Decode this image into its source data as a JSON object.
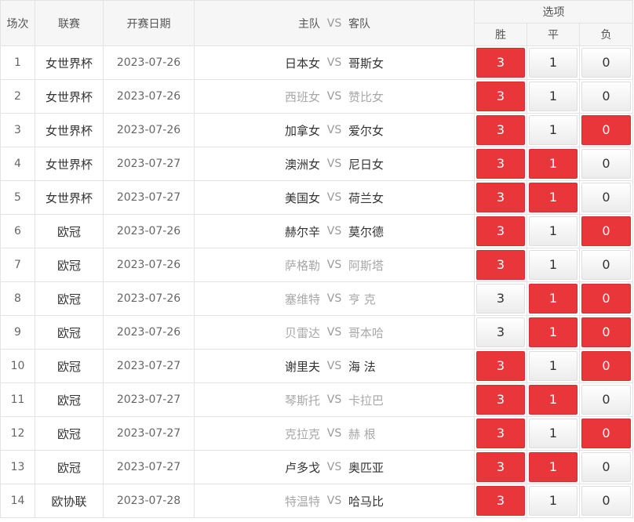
{
  "header": {
    "round": "场次",
    "league": "联赛",
    "date": "开赛日期",
    "home": "主队",
    "vs": "VS",
    "away": "客队",
    "options": "选项",
    "win": "胜",
    "draw": "平",
    "lose": "负"
  },
  "rows": [
    {
      "no": "1",
      "league": "女世界杯",
      "date": "2023-07-26",
      "home": "日本女",
      "vs": "VS",
      "away": "哥斯女",
      "win": "3",
      "draw": "1",
      "lose": "0",
      "win_sel": true,
      "draw_sel": false,
      "lose_sel": false,
      "home_dim": false,
      "away_dim": false
    },
    {
      "no": "2",
      "league": "女世界杯",
      "date": "2023-07-26",
      "home": "西班女",
      "vs": "VS",
      "away": "赞比女",
      "win": "3",
      "draw": "1",
      "lose": "0",
      "win_sel": true,
      "draw_sel": false,
      "lose_sel": false,
      "home_dim": true,
      "away_dim": true
    },
    {
      "no": "3",
      "league": "女世界杯",
      "date": "2023-07-26",
      "home": "加拿女",
      "vs": "VS",
      "away": "爱尔女",
      "win": "3",
      "draw": "1",
      "lose": "0",
      "win_sel": true,
      "draw_sel": false,
      "lose_sel": true,
      "home_dim": false,
      "away_dim": false
    },
    {
      "no": "4",
      "league": "女世界杯",
      "date": "2023-07-27",
      "home": "澳洲女",
      "vs": "VS",
      "away": "尼日女",
      "win": "3",
      "draw": "1",
      "lose": "0",
      "win_sel": true,
      "draw_sel": true,
      "lose_sel": false,
      "home_dim": false,
      "away_dim": false
    },
    {
      "no": "5",
      "league": "女世界杯",
      "date": "2023-07-27",
      "home": "美国女",
      "vs": "VS",
      "away": "荷兰女",
      "win": "3",
      "draw": "1",
      "lose": "0",
      "win_sel": true,
      "draw_sel": true,
      "lose_sel": false,
      "home_dim": false,
      "away_dim": false
    },
    {
      "no": "6",
      "league": "欧冠",
      "date": "2023-07-26",
      "home": "赫尔辛",
      "vs": "VS",
      "away": "莫尔德",
      "win": "3",
      "draw": "1",
      "lose": "0",
      "win_sel": true,
      "draw_sel": false,
      "lose_sel": true,
      "home_dim": false,
      "away_dim": false
    },
    {
      "no": "7",
      "league": "欧冠",
      "date": "2023-07-26",
      "home": "萨格勒",
      "vs": "VS",
      "away": "阿斯塔",
      "win": "3",
      "draw": "1",
      "lose": "0",
      "win_sel": true,
      "draw_sel": false,
      "lose_sel": false,
      "home_dim": true,
      "away_dim": true
    },
    {
      "no": "8",
      "league": "欧冠",
      "date": "2023-07-26",
      "home": "塞维特",
      "vs": "VS",
      "away": "亨 克",
      "win": "3",
      "draw": "1",
      "lose": "0",
      "win_sel": false,
      "draw_sel": true,
      "lose_sel": true,
      "home_dim": true,
      "away_dim": true
    },
    {
      "no": "9",
      "league": "欧冠",
      "date": "2023-07-26",
      "home": "贝雷达",
      "vs": "VS",
      "away": "哥本哈",
      "win": "3",
      "draw": "1",
      "lose": "0",
      "win_sel": false,
      "draw_sel": true,
      "lose_sel": true,
      "home_dim": true,
      "away_dim": true
    },
    {
      "no": "10",
      "league": "欧冠",
      "date": "2023-07-27",
      "home": "谢里夫",
      "vs": "VS",
      "away": "海 法",
      "win": "3",
      "draw": "1",
      "lose": "0",
      "win_sel": true,
      "draw_sel": false,
      "lose_sel": true,
      "home_dim": false,
      "away_dim": false
    },
    {
      "no": "11",
      "league": "欧冠",
      "date": "2023-07-27",
      "home": "琴斯托",
      "vs": "VS",
      "away": "卡拉巴",
      "win": "3",
      "draw": "1",
      "lose": "0",
      "win_sel": true,
      "draw_sel": true,
      "lose_sel": false,
      "home_dim": true,
      "away_dim": true
    },
    {
      "no": "12",
      "league": "欧冠",
      "date": "2023-07-27",
      "home": "克拉克",
      "vs": "VS",
      "away": "赫 根",
      "win": "3",
      "draw": "1",
      "lose": "0",
      "win_sel": true,
      "draw_sel": false,
      "lose_sel": true,
      "home_dim": true,
      "away_dim": true
    },
    {
      "no": "13",
      "league": "欧冠",
      "date": "2023-07-27",
      "home": "卢多戈",
      "vs": "VS",
      "away": "奥匹亚",
      "win": "3",
      "draw": "1",
      "lose": "0",
      "win_sel": true,
      "draw_sel": true,
      "lose_sel": false,
      "home_dim": false,
      "away_dim": false
    },
    {
      "no": "14",
      "league": "欧协联",
      "date": "2023-07-28",
      "home": "特温特",
      "vs": "VS",
      "away": "哈马比",
      "win": "3",
      "draw": "1",
      "lose": "0",
      "win_sel": true,
      "draw_sel": false,
      "lose_sel": false,
      "home_dim": true,
      "away_dim": false
    }
  ],
  "colors": {
    "selected": "#e8363b",
    "dim_text": "#a8a8a8"
  }
}
